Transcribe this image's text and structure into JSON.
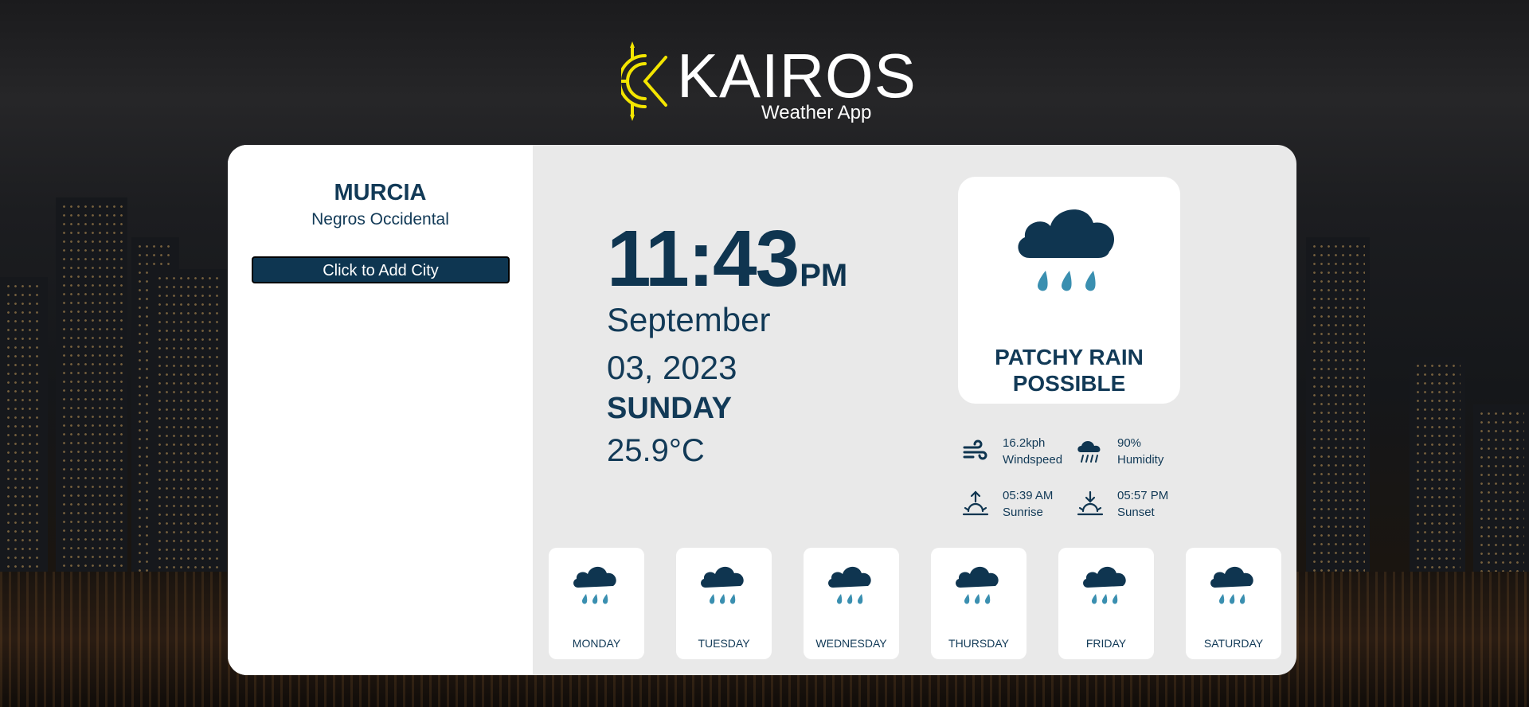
{
  "header": {
    "brand": "KAIROS",
    "tagline": "Weather App"
  },
  "location": {
    "city": "MURCIA",
    "province": "Negros Occidental",
    "add_city_label": "Click to Add City"
  },
  "current": {
    "time": "11:43",
    "ampm": "PM",
    "month": "September",
    "day_year": "03, 2023",
    "weekday": "SUNDAY",
    "temperature": "25.9°C",
    "condition": "PATCHY RAIN POSSIBLE",
    "condition_icon": "rain-cloud-icon"
  },
  "stats": {
    "windspeed_value": "16.2kph",
    "windspeed_label": "Windspeed",
    "humidity_value": "90%",
    "humidity_label": "Humidity",
    "sunrise_value": "05:39 AM",
    "sunrise_label": "Sunrise",
    "sunset_value": "05:57 PM",
    "sunset_label": "Sunset"
  },
  "forecast": [
    {
      "day": "MONDAY",
      "icon": "rain-cloud-icon"
    },
    {
      "day": "TUESDAY",
      "icon": "rain-cloud-icon"
    },
    {
      "day": "WEDNESDAY",
      "icon": "rain-cloud-icon"
    },
    {
      "day": "THURSDAY",
      "icon": "rain-cloud-icon"
    },
    {
      "day": "FRIDAY",
      "icon": "rain-cloud-icon"
    },
    {
      "day": "SATURDAY",
      "icon": "rain-cloud-icon"
    }
  ],
  "colors": {
    "primary": "#0f3550",
    "accent_drop": "#3a8fb0",
    "logo_sun": "#f3e500",
    "panel": "#e9e9e9"
  }
}
